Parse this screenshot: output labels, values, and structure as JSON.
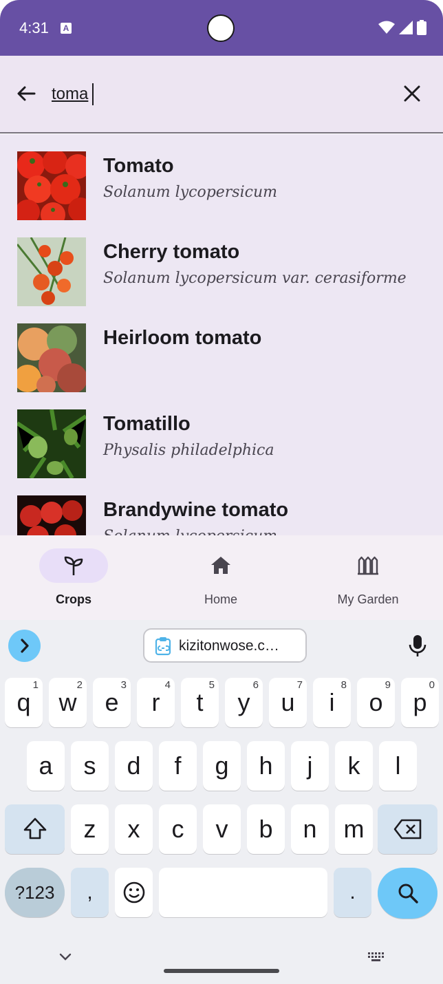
{
  "status_bar": {
    "time": "4:31",
    "notification_icon": "A",
    "icons": [
      "wifi-icon",
      "signal-icon",
      "battery-icon"
    ],
    "color": "#6750a4"
  },
  "search": {
    "query": "toma",
    "back_icon": "arrow-back-icon",
    "clear_icon": "close-icon"
  },
  "results": [
    {
      "name": "Tomato",
      "scientific": "Solanum lycopersicum",
      "image": "tomato-photo"
    },
    {
      "name": "Cherry tomato",
      "scientific": "Solanum lycopersicum var. cerasiforme",
      "image": "cherry-tomato-photo"
    },
    {
      "name": "Heirloom tomato",
      "scientific": "",
      "image": "heirloom-tomato-photo"
    },
    {
      "name": "Tomatillo",
      "scientific": "Physalis philadelphica",
      "image": "tomatillo-photo"
    },
    {
      "name": "Brandywine tomato",
      "scientific": "Solanum lycopersicum",
      "image": "brandywine-tomato-photo"
    }
  ],
  "bottom_nav": {
    "items": [
      {
        "label": "Crops",
        "icon": "seedling-icon",
        "active": true
      },
      {
        "label": "Home",
        "icon": "home-icon",
        "active": false
      },
      {
        "label": "My Garden",
        "icon": "garden-fence-icon",
        "active": false
      }
    ]
  },
  "keyboard": {
    "clipboard_suggestion": "kizitonwose.c…",
    "row1": [
      {
        "k": "q",
        "h": "1"
      },
      {
        "k": "w",
        "h": "2"
      },
      {
        "k": "e",
        "h": "3"
      },
      {
        "k": "r",
        "h": "4"
      },
      {
        "k": "t",
        "h": "5"
      },
      {
        "k": "y",
        "h": "6"
      },
      {
        "k": "u",
        "h": "7"
      },
      {
        "k": "i",
        "h": "8"
      },
      {
        "k": "o",
        "h": "9"
      },
      {
        "k": "p",
        "h": "0"
      }
    ],
    "row2": [
      "a",
      "s",
      "d",
      "f",
      "g",
      "h",
      "j",
      "k",
      "l"
    ],
    "row3": [
      "z",
      "x",
      "c",
      "v",
      "b",
      "n",
      "m"
    ],
    "symbols_label": "?123",
    "comma_label": ",",
    "period_label": ".",
    "accent_color": "#6ec8f8"
  }
}
